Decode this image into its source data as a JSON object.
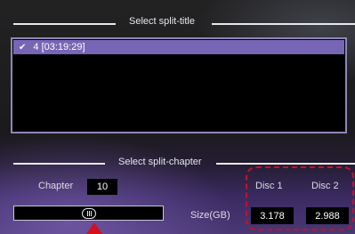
{
  "split_title_section": {
    "heading": "Select split-title",
    "items": [
      {
        "check": "✔",
        "label": "4 [03:19:29]"
      }
    ]
  },
  "split_chapter_section": {
    "heading": "Select split-chapter",
    "chapter_label": "Chapter",
    "chapter_value": "10",
    "size_label": "Size(GB)",
    "slider_position": 0.5
  },
  "discs": [
    {
      "label": "Disc 1",
      "size": "3.178"
    },
    {
      "label": "Disc 2",
      "size": "2.988"
    }
  ],
  "colors": {
    "selection": "#7766b6",
    "annotation": "#cc1020",
    "list_border": "#8f86b8"
  },
  "icons": {
    "check": "check-icon",
    "slider_grip": "grip-icon",
    "pointer": "arrow-up-icon"
  }
}
